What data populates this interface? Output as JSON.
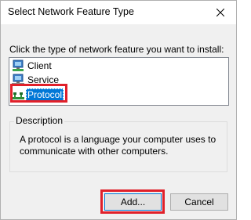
{
  "window": {
    "title": "Select Network Feature Type"
  },
  "instruction": "Click the type of network feature you want to install:",
  "feature_list": {
    "items": [
      {
        "label": "Client",
        "icon": "client-computer-icon",
        "selected": false
      },
      {
        "label": "Service",
        "icon": "service-computer-icon",
        "selected": false
      },
      {
        "label": "Protocol",
        "icon": "protocol-network-icon",
        "selected": true
      }
    ]
  },
  "description": {
    "legend": "Description",
    "line1": "A protocol is a language your computer uses to",
    "line2": "communicate with other computers."
  },
  "buttons": {
    "add": "Add...",
    "cancel": "Cancel"
  },
  "colors": {
    "selection": "#0078d7",
    "annotation_highlight": "#e0202a",
    "dialog_background": "#f0f0f0"
  }
}
